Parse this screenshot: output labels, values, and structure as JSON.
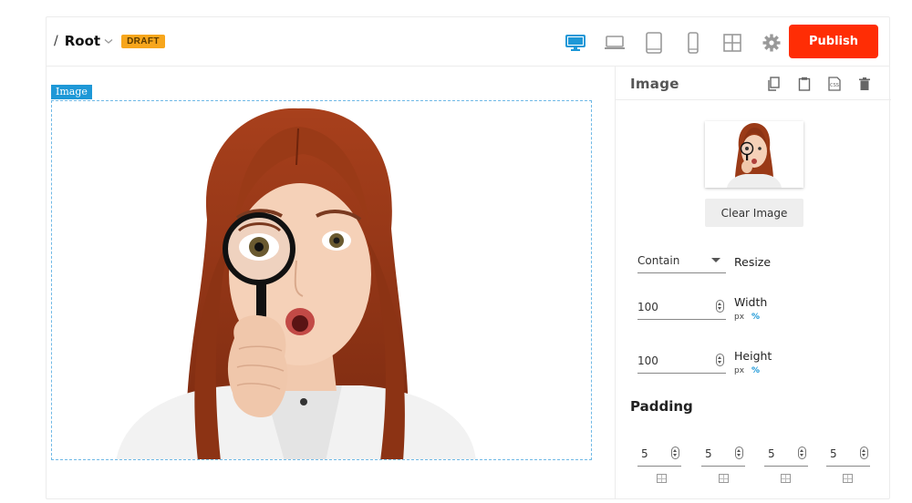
{
  "topbar": {
    "breadcrumb_separator": "/",
    "breadcrumb_root": "Root",
    "status_badge": "DRAFT",
    "publish_label": "Publish",
    "devices": [
      "desktop-icon",
      "laptop-icon",
      "tablet-icon",
      "mobile-icon",
      "grid-icon",
      "gear-icon"
    ],
    "accent_color": "#1e98d7",
    "publish_color": "#ff2d05"
  },
  "canvas": {
    "selected_label": "Image"
  },
  "panel": {
    "title": "Image",
    "actions": [
      "copy-icon",
      "paste-icon",
      "css-icon",
      "trash-icon"
    ],
    "clear_image_label": "Clear Image",
    "resize": {
      "value": "Contain",
      "label": "Resize"
    },
    "width": {
      "value": "100",
      "label": "Width",
      "unit_px": "px",
      "unit_pct": "%"
    },
    "height": {
      "value": "100",
      "label": "Height",
      "unit_px": "px",
      "unit_pct": "%"
    },
    "padding": {
      "label": "Padding",
      "values": [
        "5",
        "5",
        "5",
        "5"
      ]
    }
  }
}
